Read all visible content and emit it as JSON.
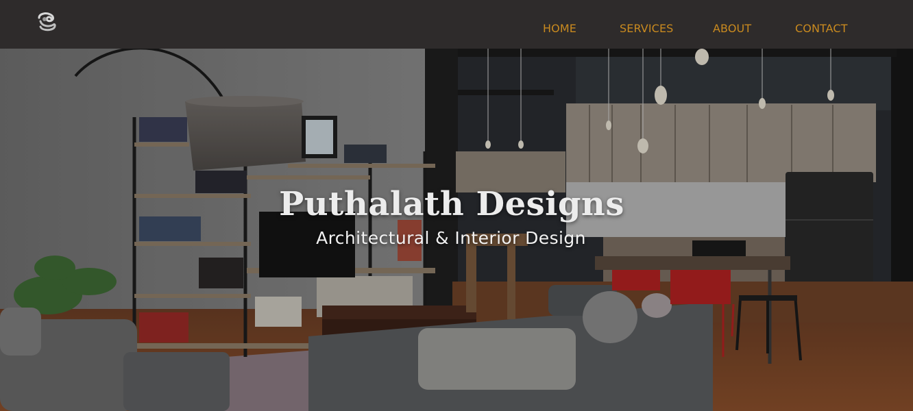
{
  "brand": {
    "logo_icon": "swirl-logo-icon"
  },
  "nav": {
    "items": [
      {
        "label": "HOME"
      },
      {
        "label": "SERVICES"
      },
      {
        "label": "ABOUT"
      },
      {
        "label": "CONTACT"
      }
    ],
    "color": "#c98a1f",
    "background": "#2e2b2b"
  },
  "hero": {
    "title": "Puthalath Designs",
    "subtitle": "Architectural & Interior Design",
    "image_subject": "living room and kitchen interior photo"
  }
}
